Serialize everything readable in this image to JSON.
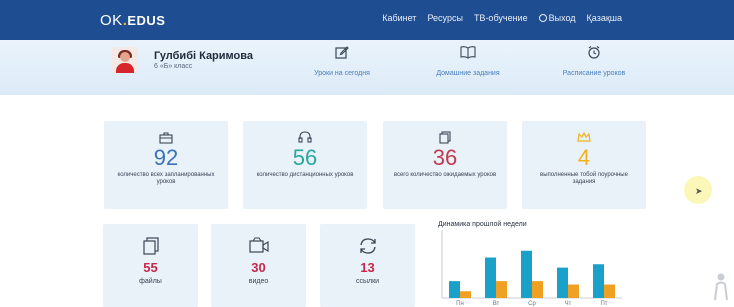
{
  "nav": {
    "logo_main": "OK",
    "logo_dot": ".",
    "logo_brand": "EDUS",
    "links": [
      "Кабинет",
      "Ресурсы",
      "ТВ-обучение",
      "Выход",
      "Қазақша"
    ]
  },
  "profile": {
    "name": "Гулбибі Каримова",
    "class": "6 «Б» класс"
  },
  "quick_links": [
    {
      "label": "Уроки на сегодня",
      "icon": "edit-icon"
    },
    {
      "label": "Домашние задания",
      "icon": "book-icon"
    },
    {
      "label": "Расписание уроков",
      "icon": "alarm-clock-icon"
    }
  ],
  "stats": [
    {
      "value": "92",
      "label": "количество всех запланированных уроков",
      "color": "#3a73b8",
      "icon": "briefcase-icon"
    },
    {
      "value": "56",
      "label": "количество дистанционных уроков",
      "color": "#2aa89c",
      "icon": "headset-icon"
    },
    {
      "value": "36",
      "label": "всего количество ожидаемых уроков",
      "color": "#c23a4e",
      "icon": "documents-icon"
    },
    {
      "value": "4",
      "label": "выполненные тобой поурочные задания",
      "color": "#f2b21b",
      "icon": "crown-icon"
    }
  ],
  "small_stats": [
    {
      "value": "55",
      "label": "файлы",
      "icon": "files-icon"
    },
    {
      "value": "30",
      "label": "видео",
      "icon": "video-camera-icon"
    },
    {
      "value": "13",
      "label": "ссылки",
      "icon": "refresh-link-icon"
    }
  ],
  "chart_data": {
    "type": "bar",
    "title": "Динамика прошлой недели",
    "categories": [
      "Пн",
      "Вт",
      "Ср",
      "Чт",
      "Пт"
    ],
    "series": [
      {
        "values": [
          5,
          12,
          14,
          9,
          10
        ],
        "color": "#1aa1c9"
      },
      {
        "values": [
          2,
          5,
          5,
          4,
          4
        ],
        "color": "#f0a124"
      }
    ],
    "ylim": [
      0,
      16
    ]
  }
}
